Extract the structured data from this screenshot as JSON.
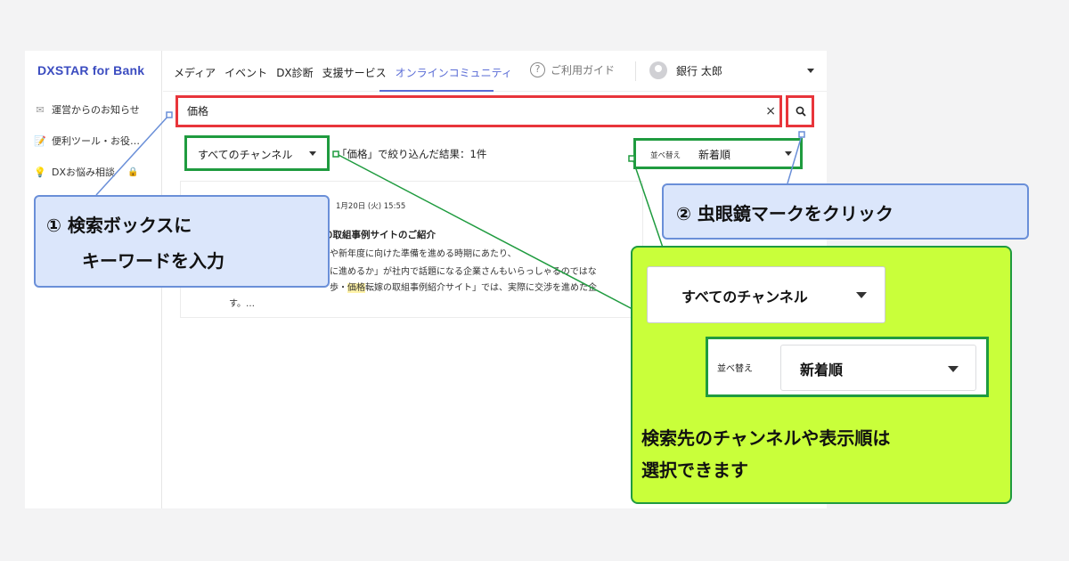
{
  "sidebar": {
    "logo": "DXSTAR for Bank",
    "items": [
      {
        "icon": "envelope-icon",
        "glyph": "✉",
        "label": "運営からのお知らせ"
      },
      {
        "icon": "memo-icon",
        "glyph": "📝",
        "label": "便利ツール・お役…"
      },
      {
        "icon": "lightbulb-icon",
        "glyph": "💡",
        "label": "DXお悩み相談"
      }
    ],
    "lock_glyph": "🔒"
  },
  "header": {
    "nav": [
      "メディア",
      "イベント",
      "DX診断",
      "支援サービス",
      "オンラインコミュニティ"
    ],
    "active_nav_index": 4,
    "guide_label": "ご利用ガイド",
    "user_name": "銀行 太郎"
  },
  "search": {
    "value": "価格",
    "clear_glyph": "×"
  },
  "filters": {
    "channel_label": "すべてのチャンネル",
    "result_text": "「価格」で絞り込んだ結果：1件",
    "sort_label": "並べ替え",
    "sort_value": "新着順"
  },
  "result_card": {
    "date": "1月20日 (火) 15:55",
    "title": "の取組事例サイトのご紹介",
    "line1": "や新年度に向けた準備を進める時期にあたり、",
    "line2": "に進めるか」が社内で話題になる企業さんもいらっしゃるのではな",
    "line3_pre": "歩・",
    "line3_hl": "価格",
    "line3_post": "転嫁の取組事例紹介サイト」では、実際に交渉を進めた企",
    "line4": "す。…"
  },
  "annotations": {
    "callout1_line1": "① 検索ボックスに",
    "callout1_line2": "キーワードを入力",
    "callout2": "② 虫眼鏡マークをクリック",
    "panel_channel": "すべてのチャンネル",
    "panel_sort_label": "並べ替え",
    "panel_sort_value": "新着順",
    "panel_text1": "検索先のチャンネルや表示順は",
    "panel_text2": "選択できます"
  },
  "colors": {
    "highlight_red": "#e8353b",
    "highlight_green": "#1f9b3f",
    "callout_blue_fill": "#dbe6fb",
    "callout_blue_border": "#6a8fd8",
    "panel_lime": "#c9ff3a",
    "accent": "#5a6cd6"
  }
}
